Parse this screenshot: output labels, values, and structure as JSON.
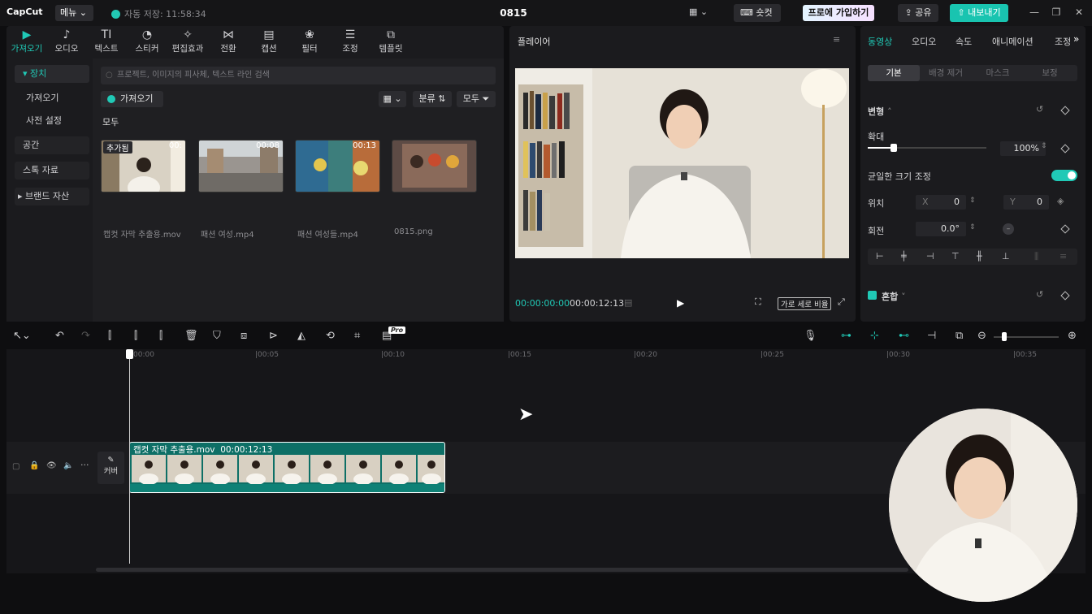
{
  "titlebar": {
    "logo": "CapCut",
    "menu": "메뉴",
    "autosave": "자동 저장: 11:58:34",
    "project": "0815",
    "shortcut": "숏컷",
    "pro": "프로에 가입하기",
    "share": "공유",
    "export": "내보내기"
  },
  "tools": [
    {
      "label": "가져오기",
      "icon": "import-icon"
    },
    {
      "label": "오디오",
      "icon": "audio-icon"
    },
    {
      "label": "텍스트",
      "glyph": "TI",
      "icon": "text-icon"
    },
    {
      "label": "스티커",
      "icon": "sticker-icon"
    },
    {
      "label": "편집효과",
      "icon": "effects-icon"
    },
    {
      "label": "전환",
      "icon": "transition-icon"
    },
    {
      "label": "캡션",
      "icon": "caption-icon"
    },
    {
      "label": "필터",
      "icon": "filter-icon"
    },
    {
      "label": "조정",
      "icon": "adjust-icon"
    },
    {
      "label": "템플릿",
      "icon": "template-icon"
    }
  ],
  "sidebar": {
    "device": "장치",
    "import": "가져오기",
    "preset": "사전 설정",
    "space": "공간",
    "stock": "스톡 자료",
    "brand": "브랜드 자산"
  },
  "media": {
    "search_placeholder": "프로젝트, 이미지의 피사체, 텍스트 라인 검색",
    "import": "가져오기",
    "sort": "분류",
    "filter": "모두",
    "all": "모두",
    "items": [
      {
        "name": "캡컷 자막 추출용.mov",
        "duration": "00:",
        "added": "추가됨"
      },
      {
        "name": "패션 여성.mp4",
        "duration": "00:08"
      },
      {
        "name": "패션 여성들.mp4",
        "duration": "00:13"
      },
      {
        "name": "0815.png",
        "duration": ""
      }
    ]
  },
  "player": {
    "title": "플레이어",
    "current": "00:00:00:00",
    "total": "00:00:12:13",
    "ratio": "가로 세로 비율"
  },
  "props": {
    "tabs": [
      "동영상",
      "오디오",
      "속도",
      "애니메이션",
      "조정"
    ],
    "subtabs": [
      "기본",
      "배경 제거",
      "마스크",
      "보정"
    ],
    "transform": "변형",
    "scale_label": "확대",
    "scale_value": "100%",
    "uniform": "균일한 크기 조정",
    "position": "위치",
    "pos_x_label": "X",
    "pos_x": "0",
    "pos_y_label": "Y",
    "pos_y": "0",
    "rotation": "회전",
    "rotation_value": "0.0°",
    "blend": "혼합"
  },
  "timeline": {
    "ticks": [
      "00:00",
      "00:05",
      "00:10",
      "00:15",
      "00:20",
      "00:25",
      "00:30",
      "00:35"
    ],
    "cover": "커버",
    "clip_name": "캡컷 자막 추출용.mov",
    "clip_duration": "00:00:12:13",
    "pro_badge": "Pro"
  },
  "colors": {
    "accent": "#20c9b6",
    "clip": "#0d6f66"
  }
}
